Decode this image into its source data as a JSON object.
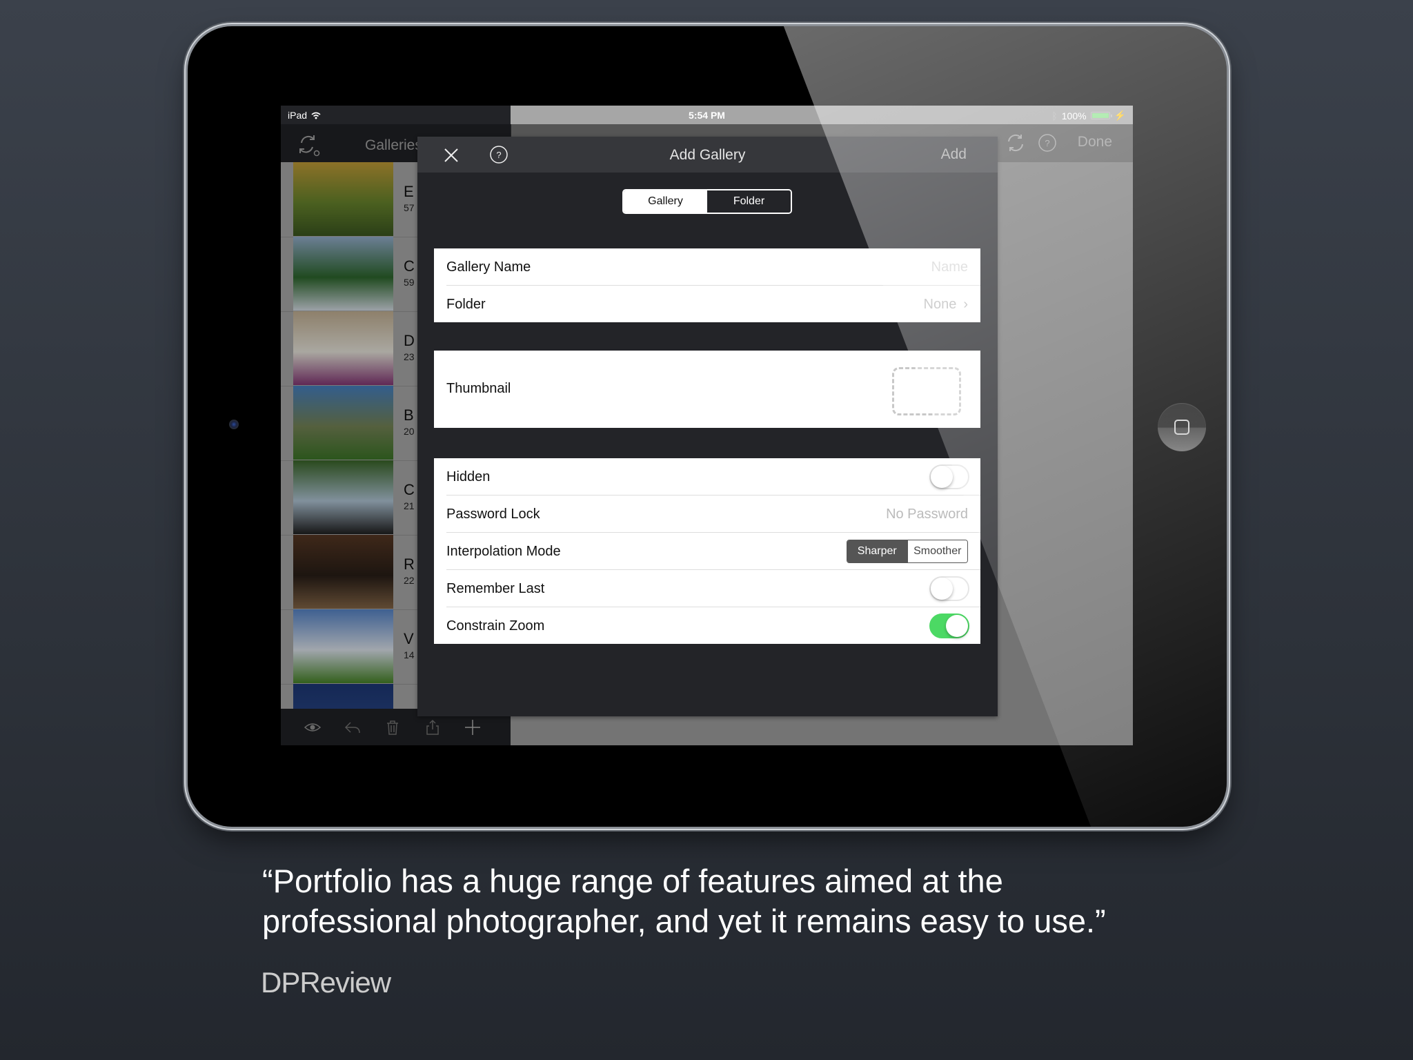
{
  "statusbar": {
    "device": "iPad",
    "time": "5:54 PM",
    "battery": "100%",
    "battery_level_percent": 100
  },
  "sidebar": {
    "title": "Galleries",
    "items": [
      {
        "name": "E",
        "count": "57",
        "colors": [
          "#c9a33a",
          "#6c8a2e",
          "#3e5b22"
        ]
      },
      {
        "name": "C",
        "count": "59",
        "colors": [
          "#9bb6d6",
          "#2f6b2f",
          "#dfe7ef"
        ]
      },
      {
        "name": "D",
        "count": "23",
        "colors": [
          "#cbb89a",
          "#f3f0e6",
          "#8a3a7a"
        ]
      },
      {
        "name": "B",
        "count": "20",
        "colors": [
          "#4a86c9",
          "#7a8a5a",
          "#3f7a2a"
        ]
      },
      {
        "name": "C",
        "count": "21",
        "colors": [
          "#3c6a2a",
          "#b9cfe0",
          "#222"
        ]
      },
      {
        "name": "R",
        "count": "22",
        "colors": [
          "#5a3a25",
          "#2a1f18",
          "#8a6a4a"
        ]
      },
      {
        "name": "V",
        "count": "14",
        "colors": [
          "#5a8ad0",
          "#e7eef7",
          "#4a8a2a"
        ]
      },
      {
        "name": "",
        "count": "",
        "colors": [
          "#1e3a7a",
          "#2c4a8c",
          "#1a2a5a"
        ]
      }
    ],
    "toolbar": [
      "eye",
      "reply",
      "trash",
      "share",
      "add"
    ]
  },
  "mainnav": {
    "done_label": "Done"
  },
  "modal": {
    "title": "Add Gallery",
    "add_label": "Add",
    "segments": [
      "Gallery",
      "Folder"
    ],
    "selected_segment": "Gallery",
    "gallery_name_label": "Gallery Name",
    "gallery_name_placeholder": "Name",
    "folder_label": "Folder",
    "folder_value": "None",
    "thumbnail_label": "Thumbnail",
    "hidden_label": "Hidden",
    "hidden_on": false,
    "password_label": "Password Lock",
    "password_value": "No Password",
    "interpolation_label": "Interpolation Mode",
    "interpolation_options": [
      "Sharper",
      "Smoother"
    ],
    "interpolation_selected": "Sharper",
    "remember_label": "Remember Last",
    "remember_on": false,
    "constrain_label": "Constrain Zoom",
    "constrain_on": true
  },
  "quote": {
    "line1": "“Portfolio has a huge range of features aimed at the",
    "line2": "professional photographer, and yet it remains easy to use.”",
    "source": "DPReview"
  },
  "colors": {
    "toggle_on": "#4cd964",
    "battery": "#8ee38e"
  }
}
